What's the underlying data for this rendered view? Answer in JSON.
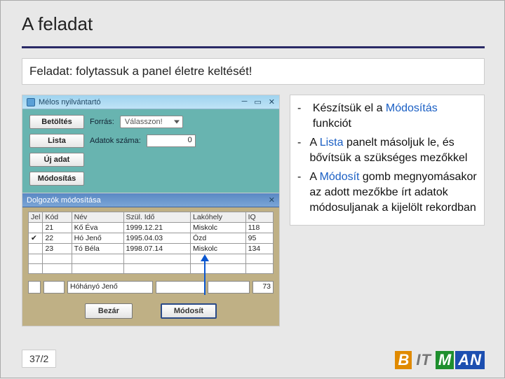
{
  "title": "A feladat",
  "subtitle": "Feladat: folytassuk a panel életre keltését!",
  "top_window": {
    "caption": "Mélos nyilvántartó",
    "rows": {
      "betoltes": "Betöltés",
      "forras_lbl": "Forrás:",
      "forras_combo": "Válasszon!",
      "lista": "Lista",
      "adatok_lbl": "Adatok száma:",
      "adatok_val": "0",
      "ujadat": "Új adat",
      "modositas": "Módosítás"
    }
  },
  "mod_window": {
    "caption": "Dolgozók módosítása",
    "headers": [
      "Jel",
      "Kód",
      "Név",
      "Szül. Idő",
      "Lakóhely",
      "IQ"
    ],
    "rows": [
      {
        "jel": "",
        "kod": "21",
        "nev": "Kő Éva",
        "szul": "1999.12.21",
        "lak": "Miskolc",
        "iq": "118"
      },
      {
        "jel": "✔",
        "kod": "22",
        "nev": "Hó Jenő",
        "szul": "1995.04.03",
        "lak": "Ózd",
        "iq": "95"
      },
      {
        "jel": "",
        "kod": "23",
        "nev": "Tó Béla",
        "szul": "1998.07.14",
        "lak": "Miskolc",
        "iq": "134"
      }
    ],
    "bottom_input": {
      "kod": "",
      "nev": "Hóhányó Jenő",
      "szul": "",
      "lak": "",
      "iq": "73"
    },
    "btn_close": "Bezár",
    "btn_modify": "Módosít"
  },
  "desc": [
    {
      "pre": "Készítsük el a ",
      "hl": "Módosítás",
      "post": " funkciót"
    },
    {
      "pre": "A ",
      "hl": "Lista",
      "post": " panelt másoljuk le, és bővítsük a szükséges mezőkkel"
    },
    {
      "pre": "A ",
      "hl": "Módosít",
      "post": " gomb megnyo­másakor az adott mezők­be írt adatok módosulja­nak a kijelölt rekordban"
    }
  ],
  "page": "37/2",
  "logo": {
    "b": "B",
    "it": "IT",
    "m": "M",
    "an": "AN"
  }
}
